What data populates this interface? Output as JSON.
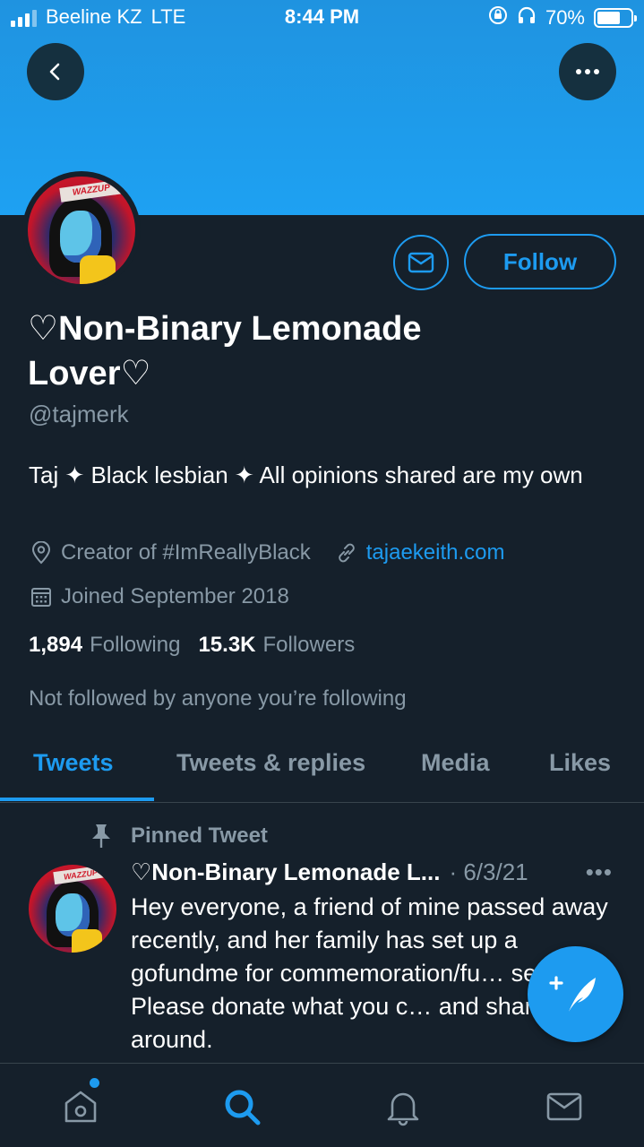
{
  "status_bar": {
    "carrier": "Beeline KZ",
    "network": "LTE",
    "time": "8:44 PM",
    "battery": "70%",
    "battery_level": 0.7
  },
  "profile": {
    "display_name": "♡Non-Binary Lemonade Lover♡",
    "handle": "@tajmerk",
    "bio": "Taj ✦ Black lesbian ✦ All opinions shared are my own",
    "location": "Creator of #ImReallyBlack",
    "website": "tajaekeith.com",
    "joined": "Joined September 2018",
    "following_count": "1,894",
    "following_label": "Following",
    "followers_count": "15.3K",
    "followers_label": "Followers",
    "not_followed_text": "Not followed by anyone you’re following",
    "avatar_badge_text": "WAZZUP",
    "follow_label": "Follow"
  },
  "tabs": [
    {
      "label": "Tweets",
      "active": true
    },
    {
      "label": "Tweets & replies",
      "active": false
    },
    {
      "label": "Media",
      "active": false
    },
    {
      "label": "Likes",
      "active": false
    }
  ],
  "pinned_tweet": {
    "pinned_label": "Pinned Tweet",
    "author": "♡Non-Binary Lemonade L...",
    "date": "· 6/3/21",
    "more": "•••",
    "text": "Hey everyone, a friend of mine passed away recently, and her family has set up a gofundme for commemoration/fu… services. Please donate what you c… and share it around."
  },
  "bottom_nav": {
    "items": [
      "home-icon",
      "search-icon",
      "bell-icon",
      "mail-icon"
    ],
    "active": "search-icon"
  },
  "colors": {
    "accent": "#1d9bf0",
    "background": "#15202b",
    "muted": "#8899a6",
    "banner": "#1ea1f2"
  }
}
